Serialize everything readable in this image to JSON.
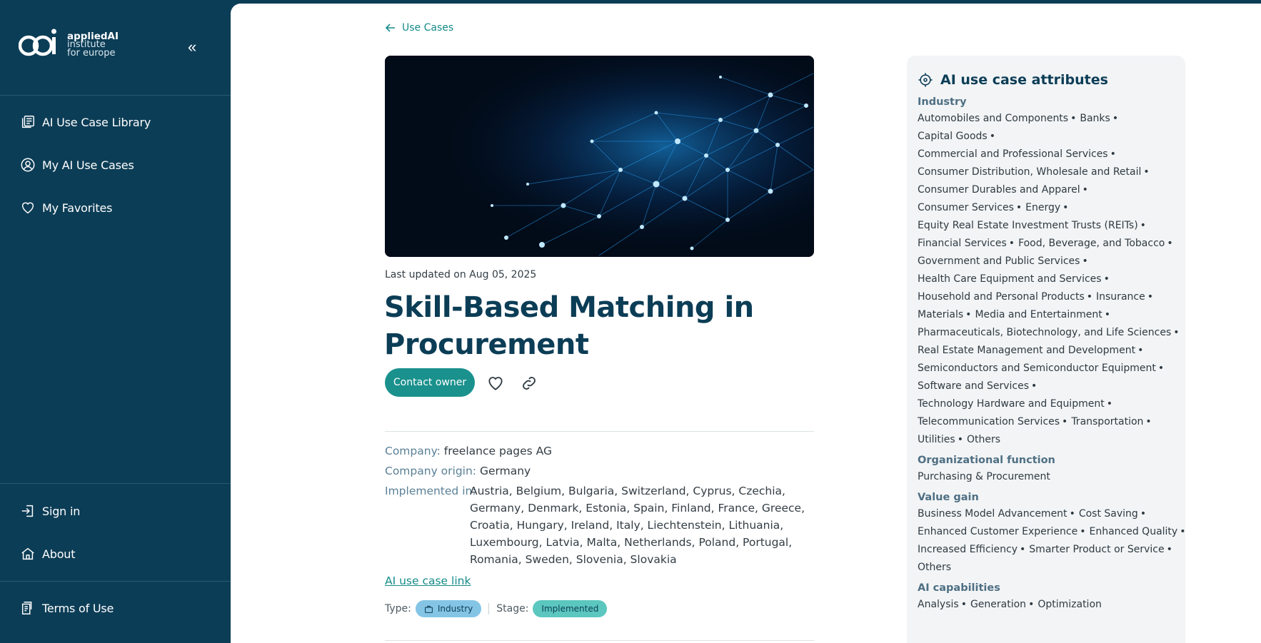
{
  "brand": {
    "line1": "appliedAI",
    "line2": "institute",
    "line3": "for europe"
  },
  "sidebar": {
    "collapse_icon": "«",
    "items": [
      {
        "label": "AI Use Case Library",
        "icon": "library-icon"
      },
      {
        "label": "My AI Use Cases",
        "icon": "user-circle-icon"
      },
      {
        "label": "My Favorites",
        "icon": "heart-icon"
      }
    ],
    "bottom_items": [
      {
        "label": "Sign in",
        "icon": "sign-in-icon"
      },
      {
        "label": "About",
        "icon": "home-icon"
      }
    ],
    "terms": {
      "label": "Terms of Use",
      "icon": "document-icon"
    }
  },
  "main": {
    "back_label": "Use Cases",
    "last_updated": "Last updated on Aug 05, 2025",
    "title": "Skill-Based Matching in Procurement",
    "contact_label": "Contact owner",
    "company_key": "Company:",
    "company_value": "freelance pages AG",
    "origin_key": "Company origin:",
    "origin_value": "Germany",
    "implemented_key": "Implemented in:",
    "implemented_value": "Austria, Belgium, Bulgaria, Switzerland, Cyprus, Czechia, Germany, Denmark, Estonia, Spain, Finland, France, Greece, Croatia, Hungary, Ireland, Italy, Liechtenstein, Lithuania, Luxembourg, Latvia, Malta, Netherlands, Poland, Portugal, Romania, Sweden, Slovenia, Slovakia",
    "link_label": "AI use case link",
    "type_key": "Type:",
    "type_value": "Industry",
    "stage_key": "Stage:",
    "stage_value": "Implemented"
  },
  "attributes": {
    "heading": "AI use case attributes",
    "groups": [
      {
        "title": "Industry",
        "lines": [
          [
            "Automobiles and Components",
            "Banks"
          ],
          [
            "Capital Goods"
          ],
          [
            "Commercial and Professional Services"
          ],
          [
            "Consumer Distribution, Wholesale and Retail"
          ],
          [
            "Consumer Durables and Apparel"
          ],
          [
            "Consumer Services",
            "Energy"
          ],
          [
            "Equity Real Estate Investment Trusts (REITs)"
          ],
          [
            "Financial Services",
            "Food, Beverage, and Tobacco"
          ],
          [
            "Government and Public Services"
          ],
          [
            "Health Care Equipment and Services"
          ],
          [
            "Household and Personal Products",
            "Insurance"
          ],
          [
            "Materials",
            "Media and Entertainment"
          ],
          [
            "Pharmaceuticals, Biotechnology, and Life Sciences"
          ],
          [
            "Real Estate Management and Development"
          ],
          [
            "Semiconductors and Semiconductor Equipment"
          ],
          [
            "Software and Services"
          ],
          [
            "Technology Hardware and Equipment"
          ],
          [
            "Telecommunication Services",
            "Transportation"
          ],
          [
            "Utilities",
            "Others"
          ]
        ]
      },
      {
        "title": "Organizational function",
        "lines": [
          [
            "Purchasing & Procurement"
          ]
        ]
      },
      {
        "title": "Value gain",
        "lines": [
          [
            "Business Model Advancement",
            "Cost Saving"
          ],
          [
            "Enhanced Customer Experience",
            "Enhanced Quality"
          ],
          [
            "Increased Efficiency",
            "Smarter Product or Service"
          ],
          [
            "Others"
          ]
        ]
      },
      {
        "title": "AI capabilities",
        "lines": [
          [
            "Analysis",
            "Generation",
            "Optimization"
          ]
        ]
      }
    ]
  },
  "colors": {
    "sidebar": "#0c3d56",
    "accent": "#1a918d",
    "title": "#0c3d56"
  }
}
